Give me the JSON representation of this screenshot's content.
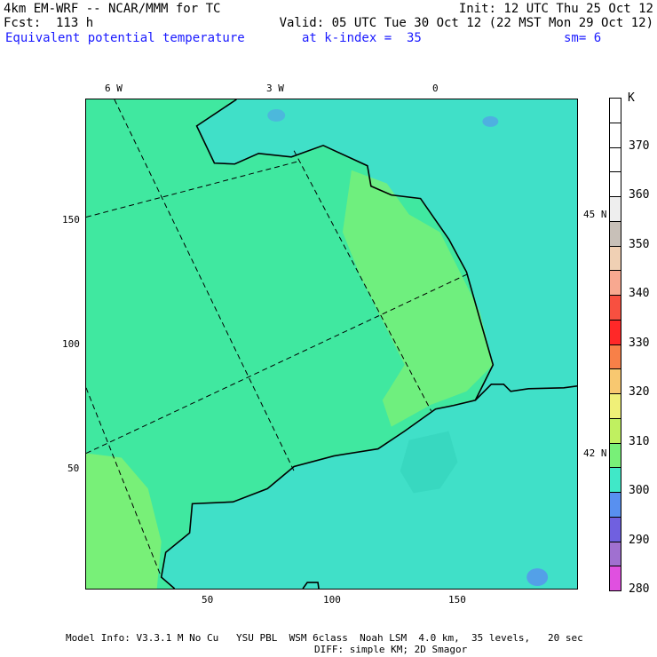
{
  "header": {
    "model": "4km EM-WRF -- NCAR/MMM for TC",
    "init": "Init: 12 UTC Thu 25 Oct 12",
    "fcst": "Fcst:  113 h",
    "valid": "Valid: 05 UTC Tue 30 Oct 12 (22 MST Mon 29 Oct 12)",
    "field": "Equivalent potential temperature",
    "level": "at k-index =  35",
    "smooth": "sm= 6"
  },
  "longitude_labels": [
    "6 W",
    "3 W",
    "0"
  ],
  "latitude_labels": [
    "45 N",
    "42 N"
  ],
  "x_ticks": [
    "50",
    "100",
    "150"
  ],
  "y_ticks": [
    "150",
    "100",
    "50"
  ],
  "legend": {
    "unit": "K",
    "labels": [
      "370",
      "360",
      "350",
      "340",
      "330",
      "320",
      "310",
      "300",
      "290",
      "280"
    ],
    "colors": [
      "#ffffff",
      "#ffffff",
      "#ffffff",
      "#ffffff",
      "#eeeeee",
      "#c8c0b8",
      "#f0d0b4",
      "#f8a890",
      "#f85040",
      "#ff2828",
      "#f88048",
      "#f8c870",
      "#f0f078",
      "#c0f060",
      "#78f078",
      "#40e8c8",
      "#5890f0",
      "#7060e0",
      "#a070d0",
      "#e050e0"
    ]
  },
  "colors": {
    "sea": "#40e0c8",
    "land": "#40e8a0",
    "land_light": "#78f078",
    "blue_patch": "#5890f0"
  },
  "footer": {
    "line1": "Model Info: V3.3.1 M No Cu   YSU PBL  WSM 6class  Noah LSM  4.0 km,  35 levels,   20 sec",
    "line2": "DIFF: simple KM; 2D Smagor"
  }
}
